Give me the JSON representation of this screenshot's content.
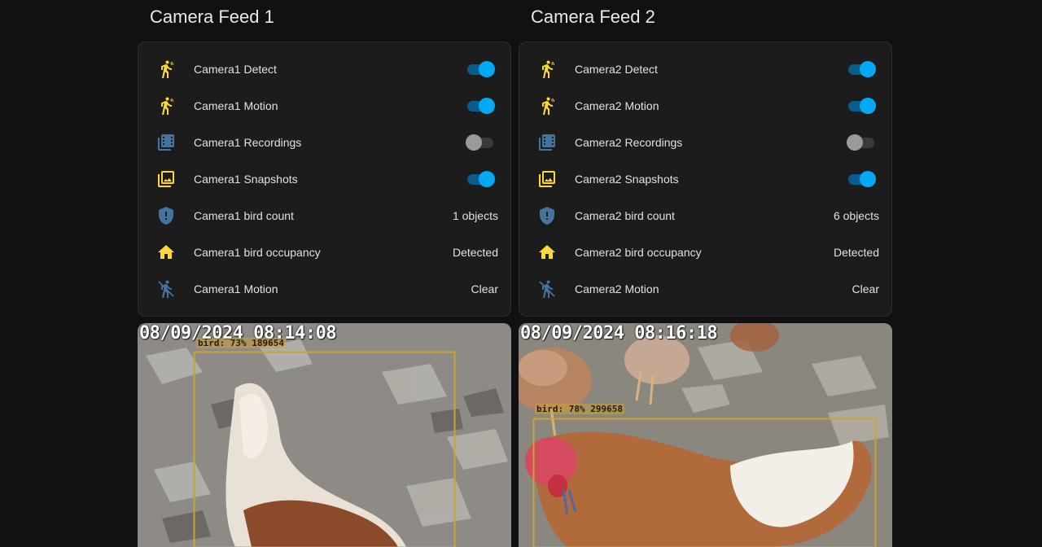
{
  "colors": {
    "accent_on": "#03a9f4",
    "icon_yellow": "#fdd835",
    "icon_blue": "#44739e",
    "bbox": "#c9a33a"
  },
  "feeds": [
    {
      "title": "Camera Feed 1",
      "rows": [
        {
          "icon": "motion-play-icon",
          "label": "Camera1 Detect",
          "kind": "toggle",
          "state": "on"
        },
        {
          "icon": "motion-play-icon",
          "label": "Camera1 Motion",
          "kind": "toggle",
          "state": "on"
        },
        {
          "icon": "filmstrip-box-multiple-icon",
          "label": "Camera1 Recordings",
          "kind": "toggle",
          "state": "off"
        },
        {
          "icon": "image-multiple-icon",
          "label": "Camera1 Snapshots",
          "kind": "toggle",
          "state": "on"
        },
        {
          "icon": "shield-alert-icon",
          "label": "Camera1 bird count",
          "kind": "value",
          "value": "1 objects"
        },
        {
          "icon": "home-icon",
          "label": "Camera1 bird occupancy",
          "kind": "value",
          "value": "Detected"
        },
        {
          "icon": "motion-off-icon",
          "label": "Camera1 Motion",
          "kind": "value",
          "value": "Clear"
        }
      ],
      "snapshot": {
        "timestamp": "08/09/2024 08:14:08",
        "detection_label": "bird: 73% 189654"
      }
    },
    {
      "title": "Camera Feed 2",
      "rows": [
        {
          "icon": "motion-play-icon",
          "label": "Camera2 Detect",
          "kind": "toggle",
          "state": "on"
        },
        {
          "icon": "motion-play-icon",
          "label": "Camera2 Motion",
          "kind": "toggle",
          "state": "on"
        },
        {
          "icon": "filmstrip-box-multiple-icon",
          "label": "Camera2 Recordings",
          "kind": "toggle",
          "state": "off"
        },
        {
          "icon": "image-multiple-icon",
          "label": "Camera2 Snapshots",
          "kind": "toggle",
          "state": "on"
        },
        {
          "icon": "shield-alert-icon",
          "label": "Camera2 bird count",
          "kind": "value",
          "value": "6 objects"
        },
        {
          "icon": "home-icon",
          "label": "Camera2 bird occupancy",
          "kind": "value",
          "value": "Detected"
        },
        {
          "icon": "motion-off-icon",
          "label": "Camera2 Motion",
          "kind": "value",
          "value": "Clear"
        }
      ],
      "snapshot": {
        "timestamp": "08/09/2024 08:16:18",
        "detection_label": "bird: 78% 299658"
      }
    }
  ]
}
